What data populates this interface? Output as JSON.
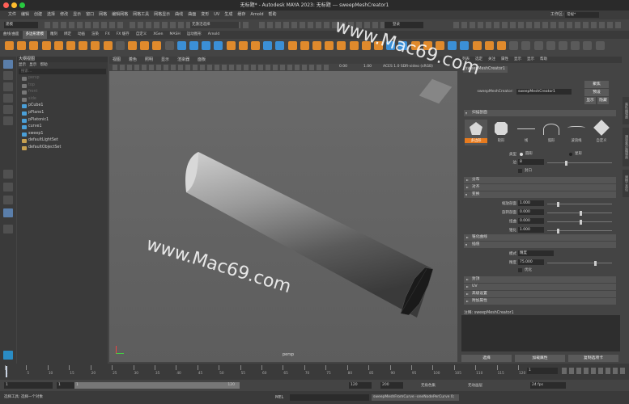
{
  "window": {
    "title": "无标题* - Autodesk MAYA 2023: 无标题 --- sweepMeshCreator1"
  },
  "menubar": [
    "文件",
    "编辑",
    "创建",
    "选择",
    "修改",
    "显示",
    "窗口",
    "网格",
    "编辑网格",
    "网格工具",
    "网格显示",
    "曲线",
    "曲面",
    "变形",
    "UV",
    "生成",
    "缓存",
    "Arnold",
    "帮助"
  ],
  "workspace": {
    "label": "工作区:",
    "value": "常规*"
  },
  "mode_select": "建模",
  "status_field": "无激活选择",
  "login_label": "登录",
  "shelf_tabs": [
    "曲线/曲面",
    "多边形建模",
    "雕刻",
    "绑定",
    "动画",
    "渲染",
    "FX",
    "FX 缓存",
    "自定义",
    "XGen",
    "MASH",
    "运动图形",
    "Arnold"
  ],
  "shelf_active": 1,
  "outliner": {
    "title": "大纲视图",
    "menus": [
      "显示",
      "显示",
      "帮助"
    ],
    "search": "搜索...",
    "items": [
      {
        "label": "persp",
        "dim": true
      },
      {
        "label": "top",
        "dim": true
      },
      {
        "label": "front",
        "dim": true
      },
      {
        "label": "side",
        "dim": true
      },
      {
        "label": "pCube1",
        "dim": false
      },
      {
        "label": "pPlane1",
        "dim": false
      },
      {
        "label": "pPlatonic1",
        "dim": false
      },
      {
        "label": "curve1",
        "dim": false
      },
      {
        "label": "sweep1",
        "dim": false
      },
      {
        "label": "defaultLightSet",
        "dim": false
      },
      {
        "label": "defaultObjectSet",
        "dim": false
      }
    ]
  },
  "viewport": {
    "menus": [
      "视图",
      "着色",
      "照明",
      "显示",
      "渲染器",
      "面板"
    ],
    "camera_label": "persp",
    "gamma": "0.00",
    "exposure": "1.00",
    "color_space": "ACES 1.0 SDR-video (sRGB)"
  },
  "attr_editor": {
    "tabs": [
      "列表",
      "选定",
      "关注",
      "属性",
      "显示",
      "显示",
      "帮助"
    ],
    "node_title": "sweepMeshCreator1",
    "node_label": "sweepMeshCreator:",
    "node_value": "sweepMeshCreator1",
    "btn_focus": "聚焦",
    "btn_preset": "预设",
    "btn_show": "显示",
    "btn_hide": "隐藏",
    "sec_profile": "扫描剖面",
    "profiles": [
      "多边形",
      "矩形",
      "线",
      "弧形",
      "波浪线",
      "自定义"
    ],
    "type_label": "类型",
    "type_opt1": "圆形",
    "type_opt2": "星形",
    "sides_label": "边",
    "sides_value": "8",
    "cap_label": "封口",
    "sec_distribution": "分布",
    "sec_alignment": "对齐",
    "sec_transform": "变换",
    "scale_label": "缩放剖面",
    "scale_value": "1.000",
    "rotate_label": "旋转剖面",
    "rotate_value": "0.000",
    "twist_label": "扭曲",
    "twist_value": "0.000",
    "taper_label": "锥化",
    "taper_value": "1.000",
    "sec_taper_curve": "锥化曲线",
    "sec_interp": "插值",
    "mode_label": "模式",
    "mode_value": "精度",
    "precision_label": "精度",
    "precision_value": "75.000",
    "optimize_label": "优化",
    "sec_caps": "封顶",
    "sec_uv": "UV",
    "sec_advanced": "高级设置",
    "sec_extra": "附加属性",
    "notes_label": "注释: sweepMeshCreator1",
    "btn_select": "选择",
    "btn_load": "加载属性",
    "btn_copy": "复制选项卡"
  },
  "side_tabs": [
    "属性编辑器",
    "通道盒/层编辑器",
    "建模工具包"
  ],
  "timeline": {
    "ticks": [
      "1",
      "5",
      "10",
      "15",
      "20",
      "25",
      "30",
      "35",
      "40",
      "45",
      "50",
      "55",
      "60",
      "65",
      "70",
      "75",
      "80",
      "85",
      "90",
      "95",
      "100",
      "105",
      "110",
      "115",
      "120"
    ],
    "current": "1"
  },
  "range": {
    "start": "1",
    "inner_start": "1",
    "inner_end": "120",
    "end": "120",
    "anim_end": "200",
    "char_set": "无角色集",
    "anim_layer": "无动画层",
    "fps": "24 fps"
  },
  "cmd": {
    "lang": "MEL",
    "command": "sweepMeshFromCurve -oneNodePerCurve 0;",
    "help": "选择工具: 选择一个对象"
  },
  "watermarks": [
    "www.Mac69.com",
    "www.Mac69.com"
  ]
}
